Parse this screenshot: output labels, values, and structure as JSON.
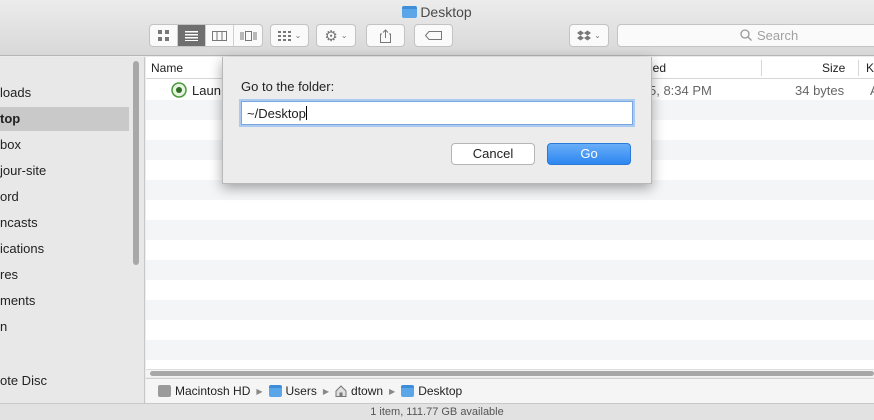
{
  "window": {
    "title": "Desktop",
    "icon": "folder-icon"
  },
  "toolbar": {
    "view_modes": [
      "icon-view",
      "list-view",
      "column-view",
      "cover-flow-view"
    ],
    "active_view": "list-view",
    "search_placeholder": "Search"
  },
  "sidebar": {
    "items": [
      {
        "label": "loads",
        "selected": false
      },
      {
        "label": "top",
        "selected": true
      },
      {
        "label": "box",
        "selected": false
      },
      {
        "label": "jour-site",
        "selected": false
      },
      {
        "label": "ord",
        "selected": false
      },
      {
        "label": "ncasts",
        "selected": false
      },
      {
        "label": "ications",
        "selected": false
      },
      {
        "label": "res",
        "selected": false
      },
      {
        "label": "ments",
        "selected": false
      },
      {
        "label": "n",
        "selected": false
      },
      {
        "label": "ote Disc",
        "selected": false
      }
    ]
  },
  "file_list": {
    "columns": {
      "name": "Name",
      "modified": "ied",
      "size": "Size",
      "kind": "K"
    },
    "rows": [
      {
        "name": "Laun",
        "modified": "5, 8:34 PM",
        "size": "34 bytes",
        "kind": "A"
      }
    ]
  },
  "pathbar": {
    "segments": [
      {
        "label": "Macintosh HD",
        "icon": "hard-drive-icon"
      },
      {
        "label": "Users",
        "icon": "folder-icon"
      },
      {
        "label": "dtown",
        "icon": "home-icon"
      },
      {
        "label": "Desktop",
        "icon": "folder-icon"
      }
    ]
  },
  "status": {
    "text": "1 item, 111.77 GB available"
  },
  "dialog": {
    "prompt": "Go to the folder:",
    "value": "~/Desktop",
    "cancel_label": "Cancel",
    "go_label": "Go"
  },
  "colors": {
    "accent": "#2d86f0",
    "selection": "#c9c9c9",
    "row_alt": "#f3f5f7"
  }
}
